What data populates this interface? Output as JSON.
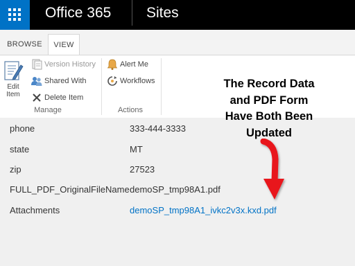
{
  "suite_bar": {
    "brand": "Office 365",
    "app_title": "Sites"
  },
  "ribbon": {
    "tabs": [
      {
        "label": "BROWSE",
        "selected": false
      },
      {
        "label": "VIEW",
        "selected": true
      }
    ],
    "edit_item": "Edit Item",
    "manage": {
      "label": "Manage",
      "version_history": "Version History",
      "shared_with": "Shared With",
      "delete_item": "Delete Item"
    },
    "actions": {
      "label": "Actions",
      "alert_me": "Alert Me",
      "workflows": "Workflows"
    }
  },
  "fields": [
    {
      "label": "phone",
      "value": "333-444-3333"
    },
    {
      "label": "state",
      "value": "MT"
    },
    {
      "label": "zip",
      "value": "27523"
    },
    {
      "label": "FULL_PDF_OriginalFileName",
      "value": "demoSP_tmp98A1.pdf"
    },
    {
      "label": "Attachments",
      "value": "demoSP_tmp98A1_ivkc2v3x.kxd.pdf"
    }
  ],
  "annotation": {
    "lines": [
      "The Record Data",
      "and PDF Form",
      "Have Both Been",
      "Updated"
    ]
  },
  "colors": {
    "accent": "#0072c6",
    "suite_bar": "#000000",
    "arrow": "#e8161d"
  }
}
